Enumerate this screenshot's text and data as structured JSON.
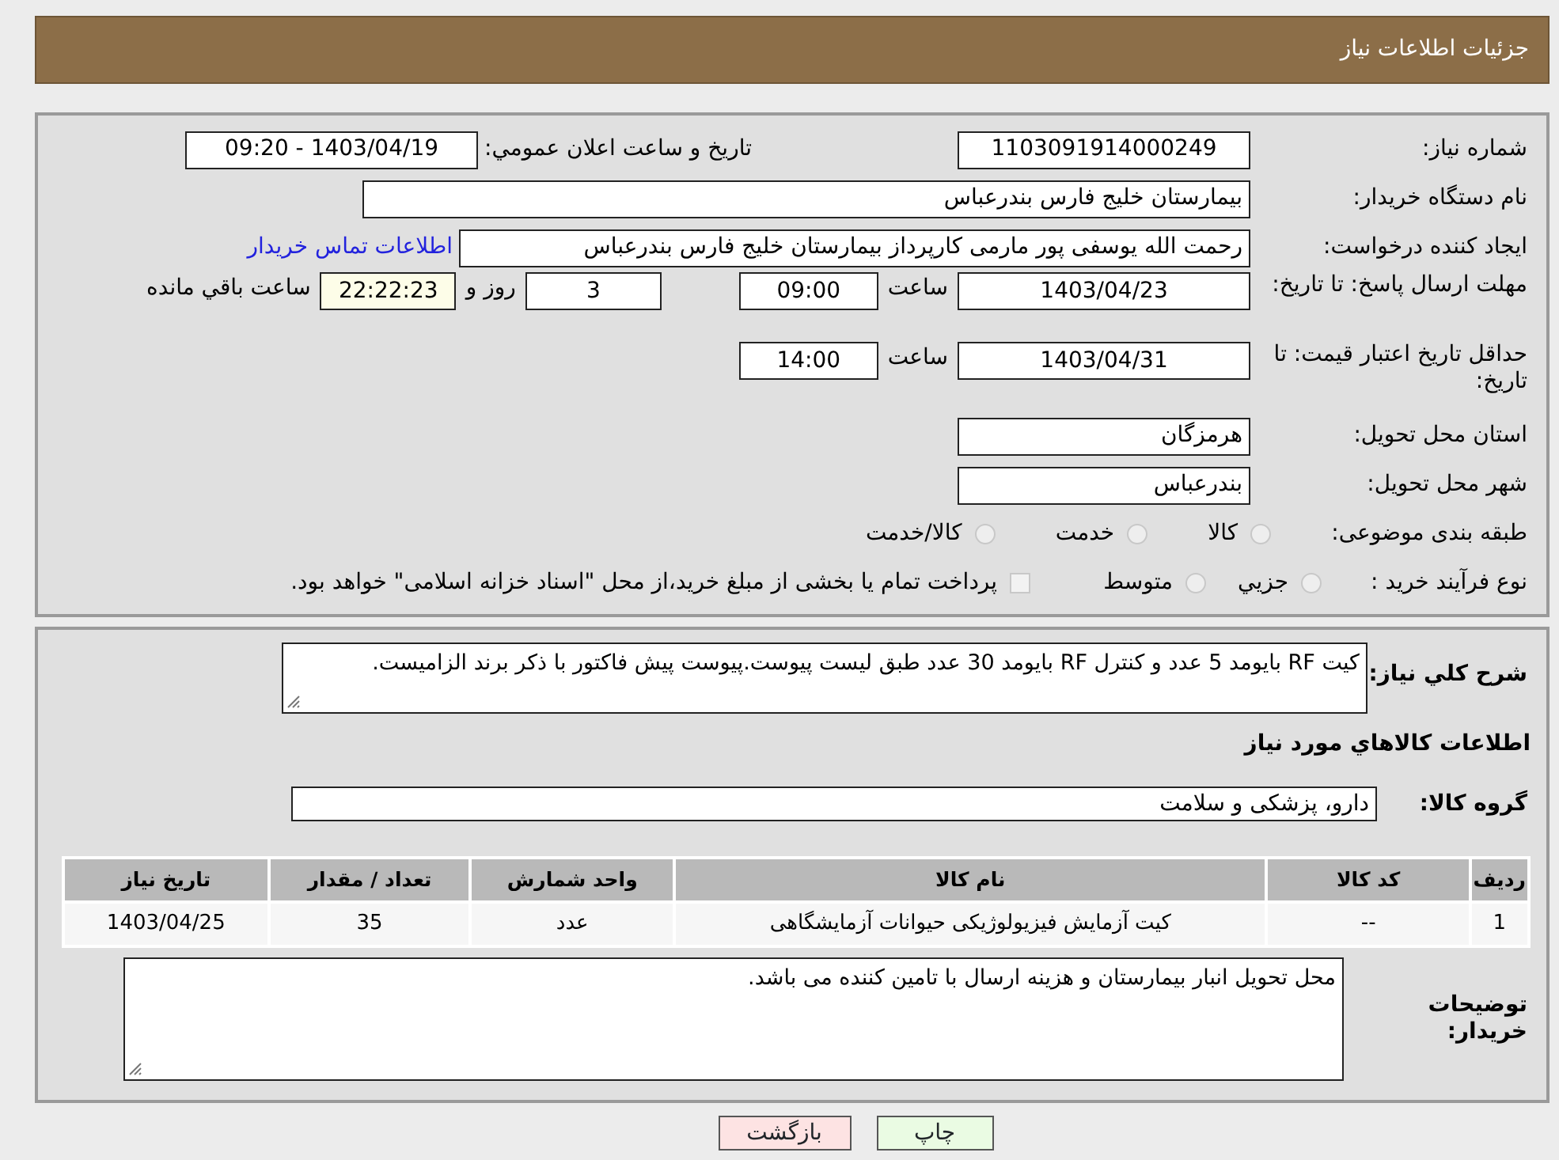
{
  "page_title": "جزئیات اطلاعات نیاز",
  "need_number": {
    "label": "شماره نیاز:",
    "value": "1103091914000249"
  },
  "announce": {
    "label": "تاريخ و ساعت اعلان عمومي:",
    "value": "1403/04/19 - 09:20"
  },
  "buyer_org": {
    "label": "نام دستگاه خریدار:",
    "value": "بیمارستان خلیج فارس بندرعباس"
  },
  "requester": {
    "label": "ایجاد کننده درخواست:",
    "value": "رحمت الله یوسفی پور مارمی کارپرداز بیمارستان خلیج فارس بندرعباس",
    "link": "اطلاعات تماس خریدار"
  },
  "reply_deadline": {
    "label": "مهلت ارسال پاسخ: تا تاریخ:",
    "date": "1403/04/23",
    "time_label": "ساعت",
    "time": "09:00",
    "days": "3",
    "days_label": "روز و",
    "remaining": "22:22:23",
    "remaining_label": "ساعت باقي مانده"
  },
  "price_validity": {
    "label": "حداقل تاریخ اعتبار قیمت: تا تاریخ:",
    "date": "1403/04/31",
    "time_label": "ساعت",
    "time": "14:00"
  },
  "province": {
    "label": "استان محل تحویل:",
    "value": "هرمزگان"
  },
  "city": {
    "label": "شهر محل تحویل:",
    "value": "بندرعباس"
  },
  "category": {
    "label": "طبقه بندی موضوعی:",
    "options": [
      {
        "label": "کالا",
        "selected": false
      },
      {
        "label": "خدمت",
        "selected": false
      },
      {
        "label": "کالا/خدمت",
        "selected": false
      }
    ]
  },
  "purchase_type": {
    "label": "نوع فرآیند خرید :",
    "options": [
      {
        "label": "جزيي",
        "selected": false
      },
      {
        "label": "متوسط",
        "selected": false
      }
    ],
    "treasury": {
      "checked": false,
      "text": "پرداخت تمام یا بخشی از مبلغ خرید،از محل \"اسناد خزانه اسلامی\" خواهد بود."
    }
  },
  "description": {
    "label": "شرح کلي نياز:",
    "value": "کیت RF بایومد 5 عدد و کنترل RF بایومد 30 عدد طبق لیست پیوست.پیوست پیش فاکتور با ذکر برند الزامیست."
  },
  "goods_heading": "اطلاعات كالاهاي مورد نياز",
  "goods_group": {
    "label": "گروه کالا:",
    "value": "دارو، پزشکی و سلامت"
  },
  "table": {
    "columns": [
      "ردیف",
      "کد کالا",
      "نام کالا",
      "واحد شمارش",
      "تعداد / مقدار",
      "تاریخ نیاز"
    ],
    "rows": [
      [
        "1",
        "--",
        "کیت آزمایش فیزیولوژیکی حیوانات آزمایشگاهی",
        "عدد",
        "35",
        "1403/04/25"
      ]
    ]
  },
  "buyer_notes": {
    "label": "توضیحات خریدار:",
    "value": "محل تحویل انبار بیمارستان و هزینه ارسال با تامین کننده می باشد."
  },
  "buttons": [
    {
      "label": "چاپ",
      "kind": "print"
    },
    {
      "label": "بازگشت",
      "kind": "back"
    }
  ]
}
